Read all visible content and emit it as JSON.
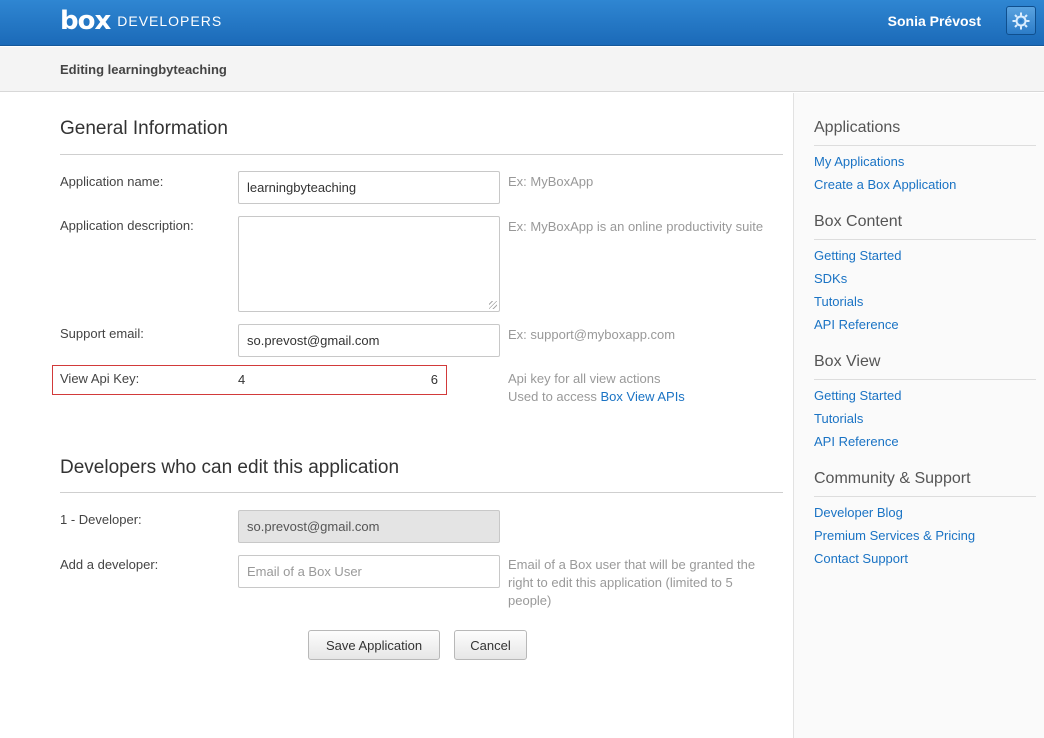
{
  "header": {
    "logo_box": "box",
    "logo_developers": "DEVELOPERS",
    "user_name": "Sonia Prévost",
    "gear_icon": "gear-icon"
  },
  "subheader": {
    "title": "Editing learningbyteaching"
  },
  "general": {
    "title": "General Information",
    "app_name": {
      "label": "Application name:",
      "value": "learningbyteaching",
      "hint": "Ex: MyBoxApp"
    },
    "app_description": {
      "label": "Application description:",
      "value": "",
      "hint": "Ex: MyBoxApp is an online productivity suite"
    },
    "support_email": {
      "label": "Support email:",
      "value": "so.prevost@gmail.com",
      "hint": "Ex: support@myboxapp.com"
    },
    "view_api_key": {
      "label": "View Api Key:",
      "value_start": "4",
      "value_end": "6",
      "hint_line1": "Api key for all view actions",
      "hint_line2": "Used to access",
      "hint_link": "Box View APIs"
    }
  },
  "developers": {
    "title": "Developers who can edit this application",
    "developer_1": {
      "label": "1 - Developer:",
      "value": "so.prevost@gmail.com"
    },
    "add_developer": {
      "label": "Add a developer:",
      "placeholder": "Email of a Box User",
      "hint": "Email of a Box user that will be granted the right to edit this application (limited to 5 people)"
    }
  },
  "buttons": {
    "save": "Save Application",
    "cancel": "Cancel"
  },
  "sidebar": {
    "applications": {
      "heading": "Applications",
      "links": [
        "My Applications",
        "Create a Box Application"
      ]
    },
    "box_content": {
      "heading": "Box Content",
      "links": [
        "Getting Started",
        "SDKs",
        "Tutorials",
        "API Reference"
      ]
    },
    "box_view": {
      "heading": "Box View",
      "links": [
        "Getting Started",
        "Tutorials",
        "API Reference"
      ]
    },
    "community": {
      "heading": "Community & Support",
      "links": [
        "Developer Blog",
        "Premium Services & Pricing",
        "Contact Support"
      ]
    }
  },
  "colors": {
    "topbar": "#2278c6",
    "link": "#1a73c4",
    "highlight": "#d23a3a"
  }
}
